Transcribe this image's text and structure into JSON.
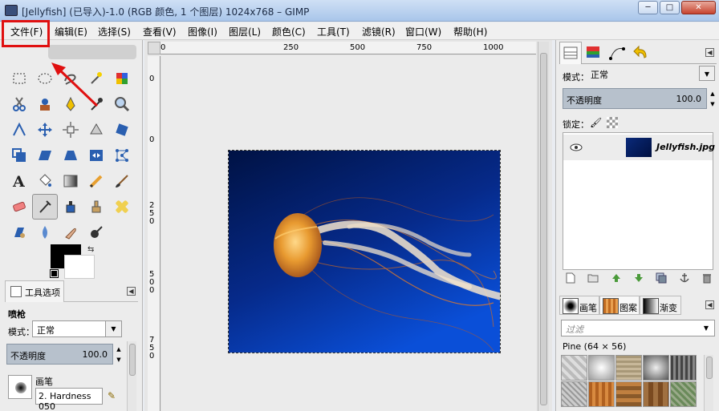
{
  "window": {
    "title": "[Jellyfish] (已导入)-1.0 (RGB 颜色, 1 个图层) 1024x768 – GIMP",
    "min": "─",
    "max": "□",
    "close": "✕"
  },
  "menu": [
    "文件(F)",
    "编辑(E)",
    "选择(S)",
    "查看(V)",
    "图像(I)",
    "图层(L)",
    "颜色(C)",
    "工具(T)",
    "滤镜(R)",
    "窗口(W)",
    "帮助(H)"
  ],
  "colors": {
    "highlight": "#e01010",
    "arrow": "#e01010",
    "selection": "#d8c800",
    "image_top": "#001244",
    "image_bottom": "#0a4fd8"
  },
  "ruler": {
    "h_ticks": [
      "0",
      "250",
      "500",
      "750",
      "1000"
    ],
    "v_ticks": [
      "0",
      "2 5 0",
      "5 0 0",
      "7 5 0"
    ],
    "top_left": "0",
    "top_right": ""
  },
  "toolbox": {
    "tools": [
      "rect-select-icon",
      "ellipse-select-icon",
      "free-select-icon",
      "fuzzy-select-icon",
      "color-select-icon",
      "scissors-icon",
      "foreground-select-icon",
      "paths-icon",
      "color-picker-icon",
      "zoom-icon",
      "measure-icon",
      "move-icon",
      "align-icon",
      "crop-icon",
      "rotate-icon",
      "scale-icon",
      "shear-icon",
      "perspective-icon",
      "flip-icon",
      "cage-icon",
      "text-icon",
      "bucket-fill-icon",
      "blend-icon",
      "pencil-icon",
      "paintbrush-icon",
      "eraser-icon",
      "airbrush-icon",
      "ink-icon",
      "clone-icon",
      "heal-icon",
      "perspective-clone-icon",
      "blur-icon",
      "smudge-icon",
      "dodge-burn-icon",
      "unused"
    ],
    "selected_tool": 26,
    "options_tab": "工具选项",
    "tool_name": "喷枪",
    "mode_label": "模式：",
    "mode_value": "正常",
    "opacity_label": "不透明度",
    "opacity_value": "100.0",
    "brush_label": "画笔",
    "brush_value": "2. Hardness 050"
  },
  "dock": {
    "mode_label": "模式：",
    "mode_value": "正常",
    "opacity_label": "不透明度",
    "opacity_value": "100.0",
    "lock_label": "锁定：",
    "layer_name": "Jellyfish.jpg",
    "tabs2": [
      "画笔",
      "图案",
      "渐变"
    ],
    "filter_placeholder": "过滤",
    "pattern_label": "Pine (64 × 56)"
  }
}
